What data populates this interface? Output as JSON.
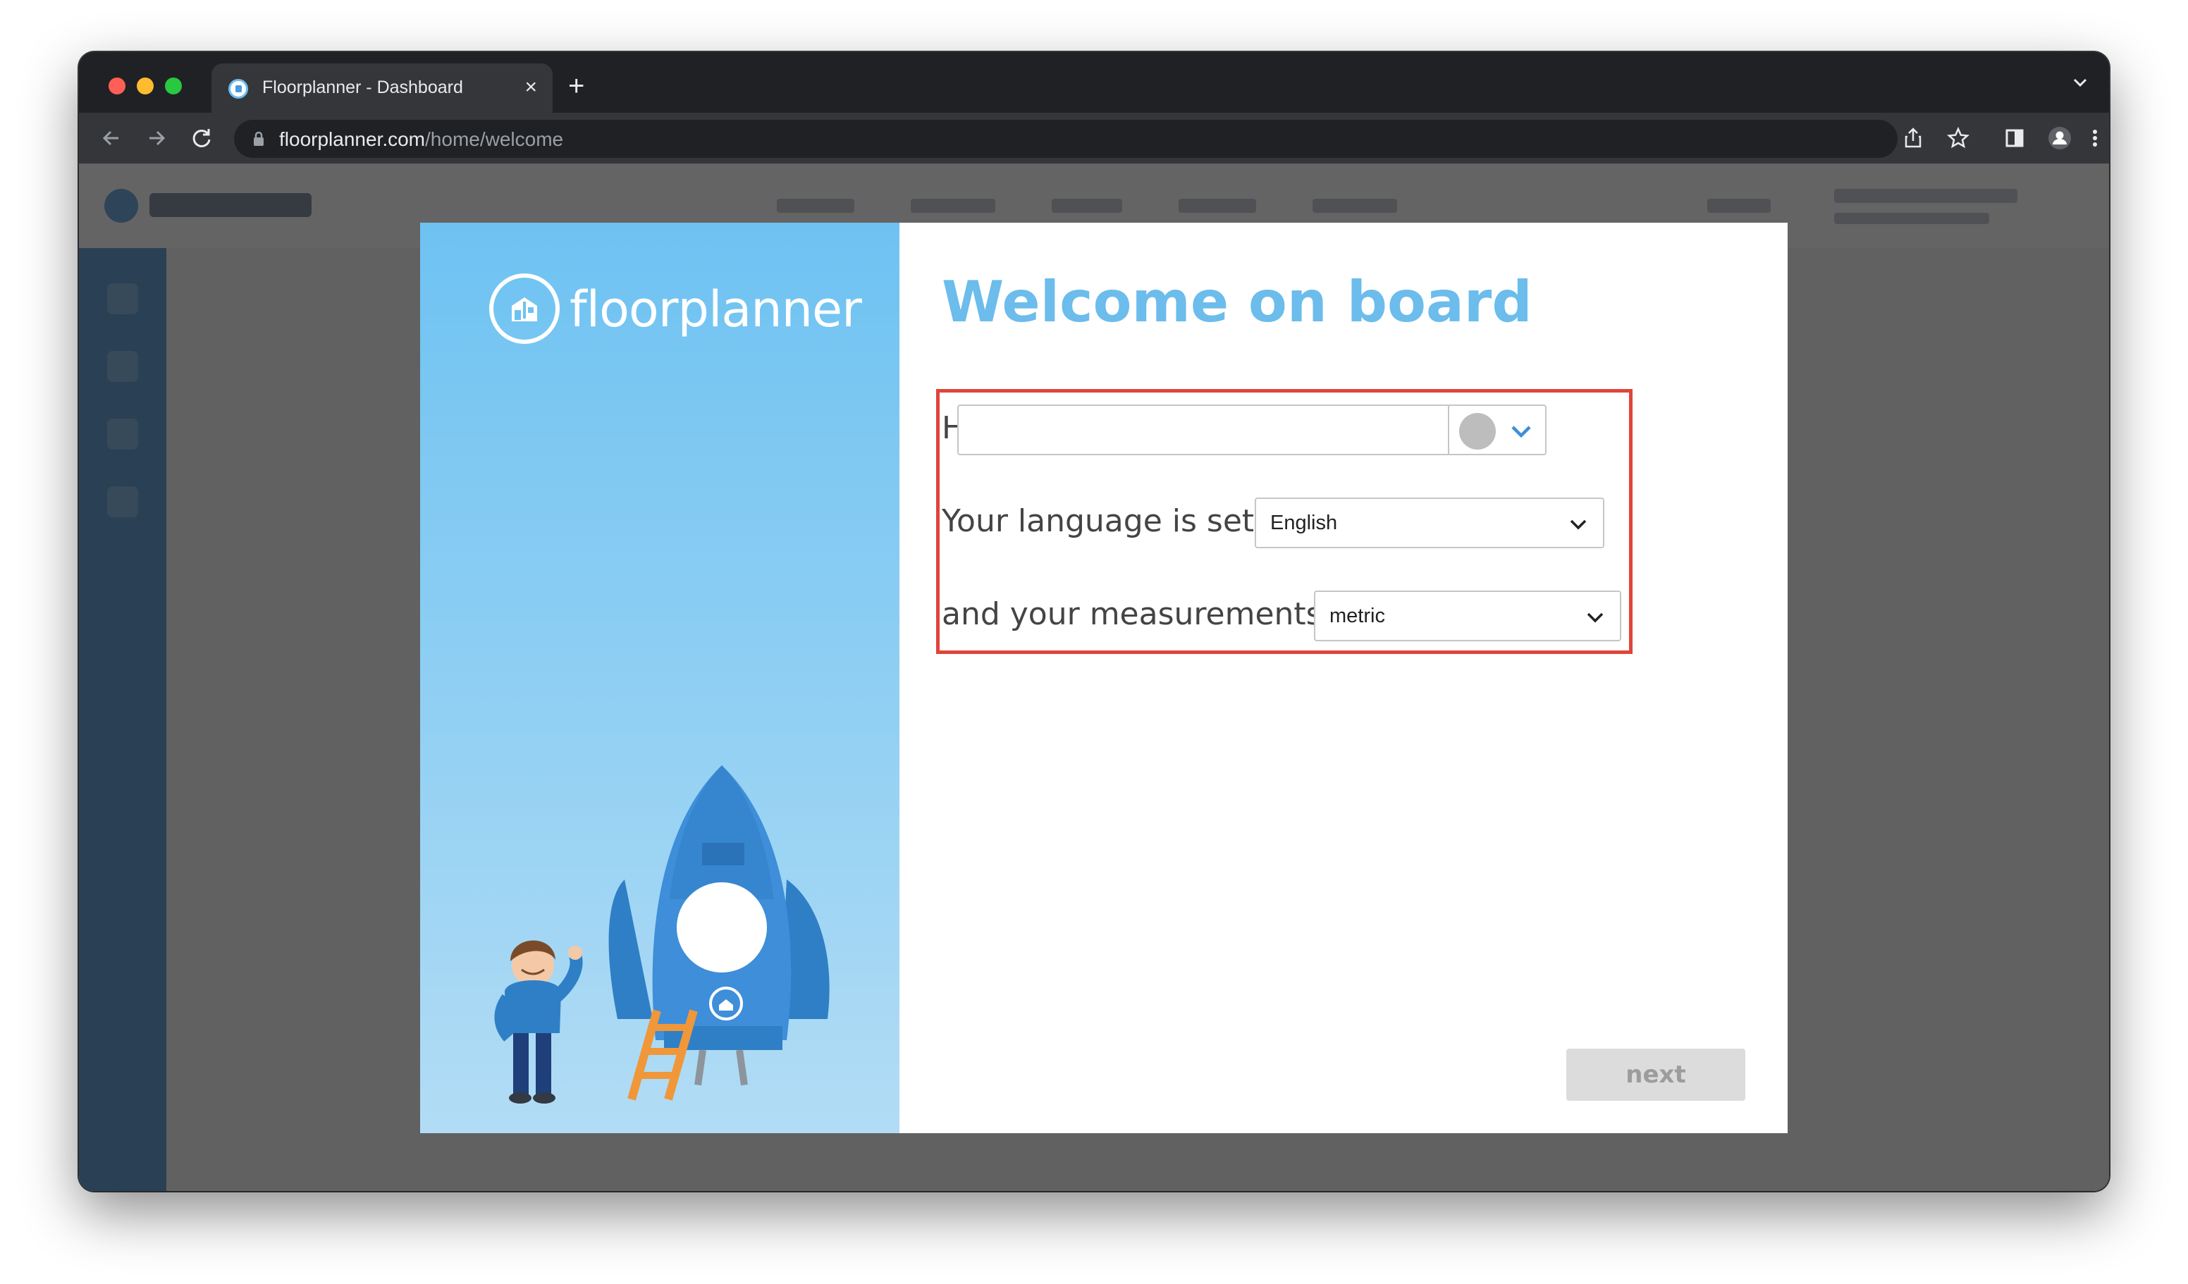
{
  "browser": {
    "tab_title": "Floorplanner - Dashboard",
    "tab_close": "×",
    "new_tab": "+",
    "url_domain": "floorplanner.com",
    "url_path": "/home/welcome"
  },
  "modal": {
    "brand_name": "floorplanner",
    "title": "Welcome on board",
    "greeting_label": "Hi",
    "name_value": "",
    "language_label": "Your language is set to",
    "language_value": "English",
    "measurement_label": "and your measurements to",
    "measurement_value": "metric",
    "next_label": "next"
  },
  "colors": {
    "accent": "#6cbcec",
    "highlight": "#e0443a",
    "panel_top": "#6ec2f2",
    "panel_bottom": "#b2dcf5",
    "button_disabled": "#dcdcdc"
  },
  "icons": [
    "favicon-icon",
    "close-icon",
    "plus-icon",
    "tab-list-icon",
    "back-icon",
    "forward-icon",
    "reload-icon",
    "lock-icon",
    "share-icon",
    "star-icon",
    "sidebar-icon",
    "profile-icon",
    "more-icon",
    "chevron-down-icon",
    "avatar-placeholder-icon"
  ]
}
